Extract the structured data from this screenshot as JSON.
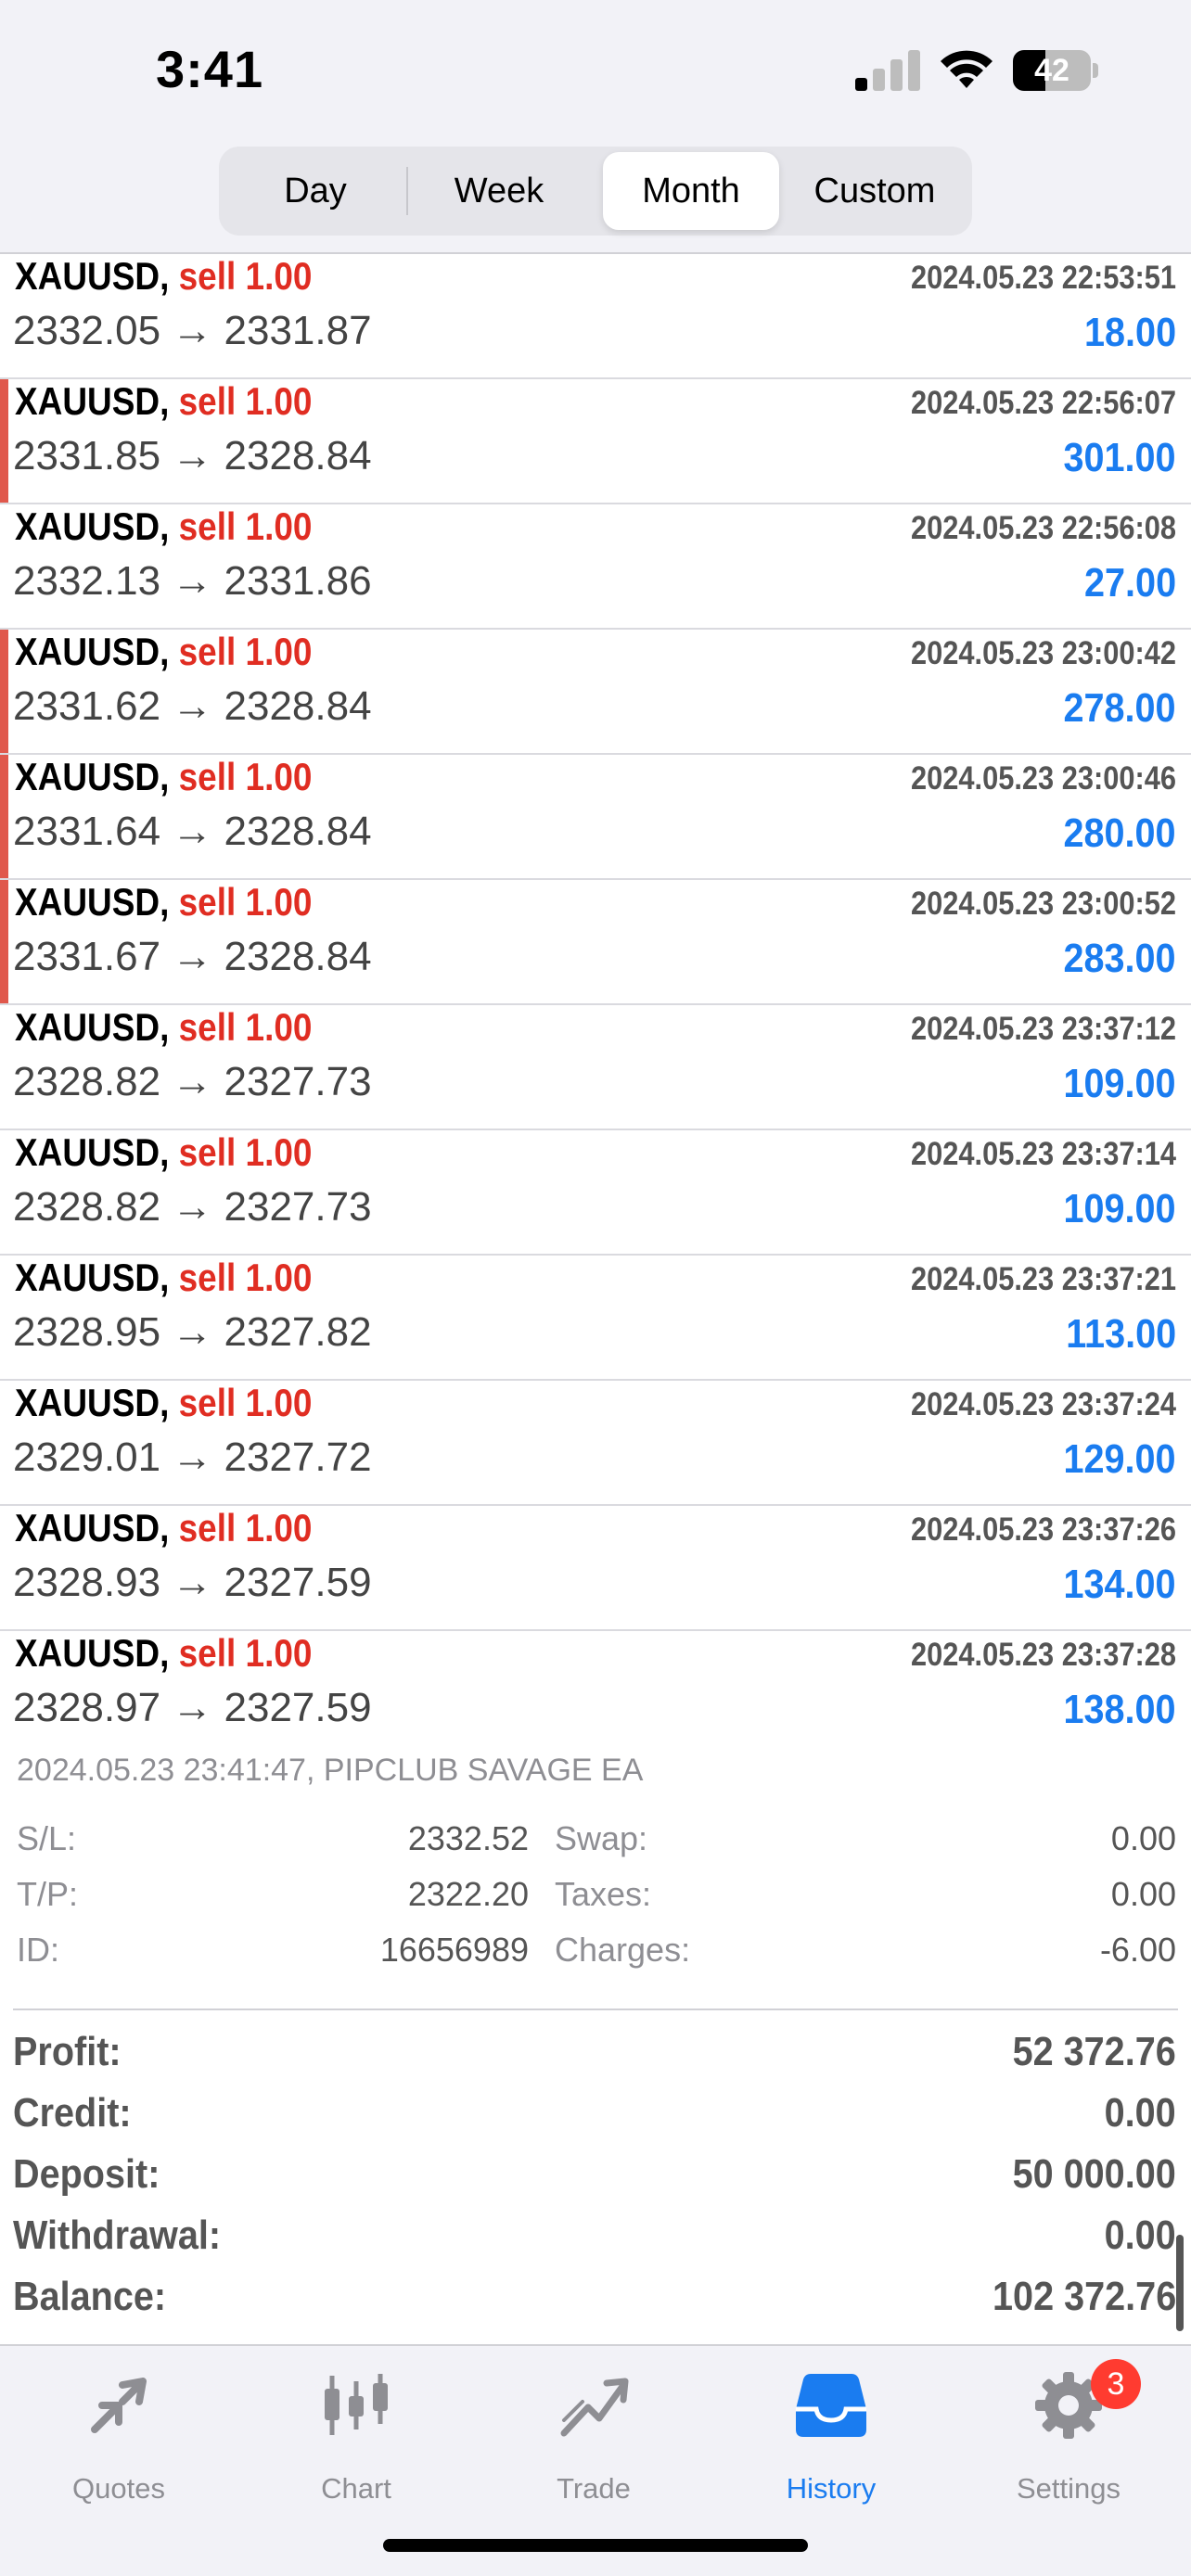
{
  "status_bar": {
    "time": "3:41",
    "battery_percent": "42",
    "battery_level": 0.42,
    "signal_bars_active": 1,
    "signal_bars_total": 4
  },
  "period_selector": {
    "options": [
      "Day",
      "Week",
      "Month",
      "Custom"
    ],
    "selected": "Month"
  },
  "deals": [
    {
      "symbol": "XAUUSD,",
      "side": "sell 1.00",
      "datetime": "2024.05.23 22:53:51",
      "prices": "2332.05 → 2331.87",
      "profit": "18.00",
      "marked": false
    },
    {
      "symbol": "XAUUSD,",
      "side": "sell 1.00",
      "datetime": "2024.05.23 22:56:07",
      "prices": "2331.85 → 2328.84",
      "profit": "301.00",
      "marked": true
    },
    {
      "symbol": "XAUUSD,",
      "side": "sell 1.00",
      "datetime": "2024.05.23 22:56:08",
      "prices": "2332.13 → 2331.86",
      "profit": "27.00",
      "marked": false
    },
    {
      "symbol": "XAUUSD,",
      "side": "sell 1.00",
      "datetime": "2024.05.23 23:00:42",
      "prices": "2331.62 → 2328.84",
      "profit": "278.00",
      "marked": true
    },
    {
      "symbol": "XAUUSD,",
      "side": "sell 1.00",
      "datetime": "2024.05.23 23:00:46",
      "prices": "2331.64 → 2328.84",
      "profit": "280.00",
      "marked": true
    },
    {
      "symbol": "XAUUSD,",
      "side": "sell 1.00",
      "datetime": "2024.05.23 23:00:52",
      "prices": "2331.67 → 2328.84",
      "profit": "283.00",
      "marked": true
    },
    {
      "symbol": "XAUUSD,",
      "side": "sell 1.00",
      "datetime": "2024.05.23 23:37:12",
      "prices": "2328.82 → 2327.73",
      "profit": "109.00",
      "marked": false
    },
    {
      "symbol": "XAUUSD,",
      "side": "sell 1.00",
      "datetime": "2024.05.23 23:37:14",
      "prices": "2328.82 → 2327.73",
      "profit": "109.00",
      "marked": false
    },
    {
      "symbol": "XAUUSD,",
      "side": "sell 1.00",
      "datetime": "2024.05.23 23:37:21",
      "prices": "2328.95 → 2327.82",
      "profit": "113.00",
      "marked": false
    },
    {
      "symbol": "XAUUSD,",
      "side": "sell 1.00",
      "datetime": "2024.05.23 23:37:24",
      "prices": "2329.01 → 2327.72",
      "profit": "129.00",
      "marked": false
    },
    {
      "symbol": "XAUUSD,",
      "side": "sell 1.00",
      "datetime": "2024.05.23 23:37:26",
      "prices": "2328.93 → 2327.59",
      "profit": "134.00",
      "marked": false
    },
    {
      "symbol": "XAUUSD,",
      "side": "sell 1.00",
      "datetime": "2024.05.23 23:37:28",
      "prices": "2328.97 → 2327.59",
      "profit": "138.00",
      "marked": false
    }
  ],
  "detail": {
    "info": "2024.05.23 23:41:47, PIPCLUB SAVAGE EA",
    "sl_label": "S/L:",
    "sl_value": "2332.52",
    "swap_label": "Swap:",
    "swap_value": "0.00",
    "tp_label": "T/P:",
    "tp_value": "2322.20",
    "taxes_label": "Taxes:",
    "taxes_value": "0.00",
    "id_label": "ID:",
    "id_value": "16656989",
    "charges_label": "Charges:",
    "charges_value": "-6.00"
  },
  "totals": {
    "profit_label": "Profit:",
    "profit_value": "52 372.76",
    "credit_label": "Credit:",
    "credit_value": "0.00",
    "deposit_label": "Deposit:",
    "deposit_value": "50 000.00",
    "withdrawal_label": "Withdrawal:",
    "withdrawal_value": "0.00",
    "balance_label": "Balance:",
    "balance_value": "102 372.76"
  },
  "tabbar": {
    "quotes": "Quotes",
    "chart": "Chart",
    "trade": "Trade",
    "history": "History",
    "settings": "Settings",
    "settings_badge": "3",
    "active": "History"
  },
  "colors": {
    "accent": "#1a7cf0",
    "sell": "#e02d22",
    "marker": "#e0584c",
    "badge": "#ff3b30"
  }
}
